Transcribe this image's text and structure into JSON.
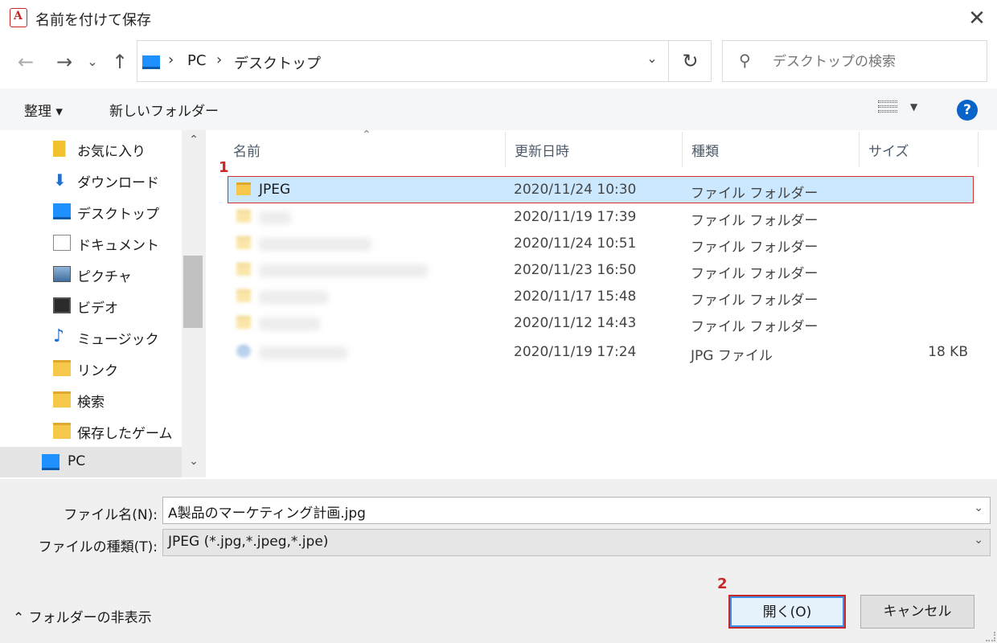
{
  "window": {
    "title": "名前を付けて保存",
    "close": "✕"
  },
  "nav": {
    "back": "←",
    "forward": "→",
    "recent": "⌄",
    "up": "↑",
    "breadcrumbs": [
      "PC",
      "デスクトップ"
    ],
    "sep": "›",
    "dropdown": "⌄",
    "refresh": "↻",
    "search_placeholder": "デスクトップの検索"
  },
  "toolbar": {
    "organize": "整理 ▾",
    "new_folder": "新しいフォルダー",
    "help": "?"
  },
  "sidebar": {
    "items": [
      {
        "label": "お気に入り",
        "icon": "star-folder-icon"
      },
      {
        "label": "ダウンロード",
        "icon": "download-icon"
      },
      {
        "label": "デスクトップ",
        "icon": "desktop-icon"
      },
      {
        "label": "ドキュメント",
        "icon": "document-icon"
      },
      {
        "label": "ピクチャ",
        "icon": "pictures-icon"
      },
      {
        "label": "ビデオ",
        "icon": "video-icon"
      },
      {
        "label": "ミュージック",
        "icon": "music-icon"
      },
      {
        "label": "リンク",
        "icon": "link-folder-icon"
      },
      {
        "label": "検索",
        "icon": "search-folder-icon"
      },
      {
        "label": "保存したゲーム",
        "icon": "saved-games-icon"
      },
      {
        "label": "PC",
        "icon": "pc-icon"
      }
    ]
  },
  "columns": {
    "name": "名前",
    "modified": "更新日時",
    "type": "種類",
    "size": "サイズ"
  },
  "files": [
    {
      "name": "JPEG",
      "date": "2020/11/24 10:30",
      "type": "ファイル フォルダー",
      "size": ""
    },
    {
      "name": "",
      "date": "2020/11/19 17:39",
      "type": "ファイル フォルダー",
      "size": ""
    },
    {
      "name": "",
      "date": "2020/11/24 10:51",
      "type": "ファイル フォルダー",
      "size": ""
    },
    {
      "name": "",
      "date": "2020/11/23 16:50",
      "type": "ファイル フォルダー",
      "size": ""
    },
    {
      "name": "",
      "date": "2020/11/17 15:48",
      "type": "ファイル フォルダー",
      "size": ""
    },
    {
      "name": "",
      "date": "2020/11/12 14:43",
      "type": "ファイル フォルダー",
      "size": ""
    },
    {
      "name": "",
      "date": "2020/11/19 17:24",
      "type": "JPG ファイル",
      "size": "18 KB"
    }
  ],
  "callouts": {
    "one": "1",
    "two": "2"
  },
  "form": {
    "filename_label": "ファイル名(N):",
    "filename_value": "A製品のマーケティング計画.jpg",
    "filetype_label": "ファイルの種類(T):",
    "filetype_value": "JPEG (*.jpg,*.jpeg,*.jpe)",
    "dropdown": "⌄"
  },
  "footer": {
    "hide_folders": "⌃ フォルダーの非表示",
    "open": "開く(O)",
    "cancel": "キャンセル"
  },
  "colors": {
    "accent": "#0a63c9",
    "highlight": "#cce8ff",
    "callout": "#c62828"
  }
}
